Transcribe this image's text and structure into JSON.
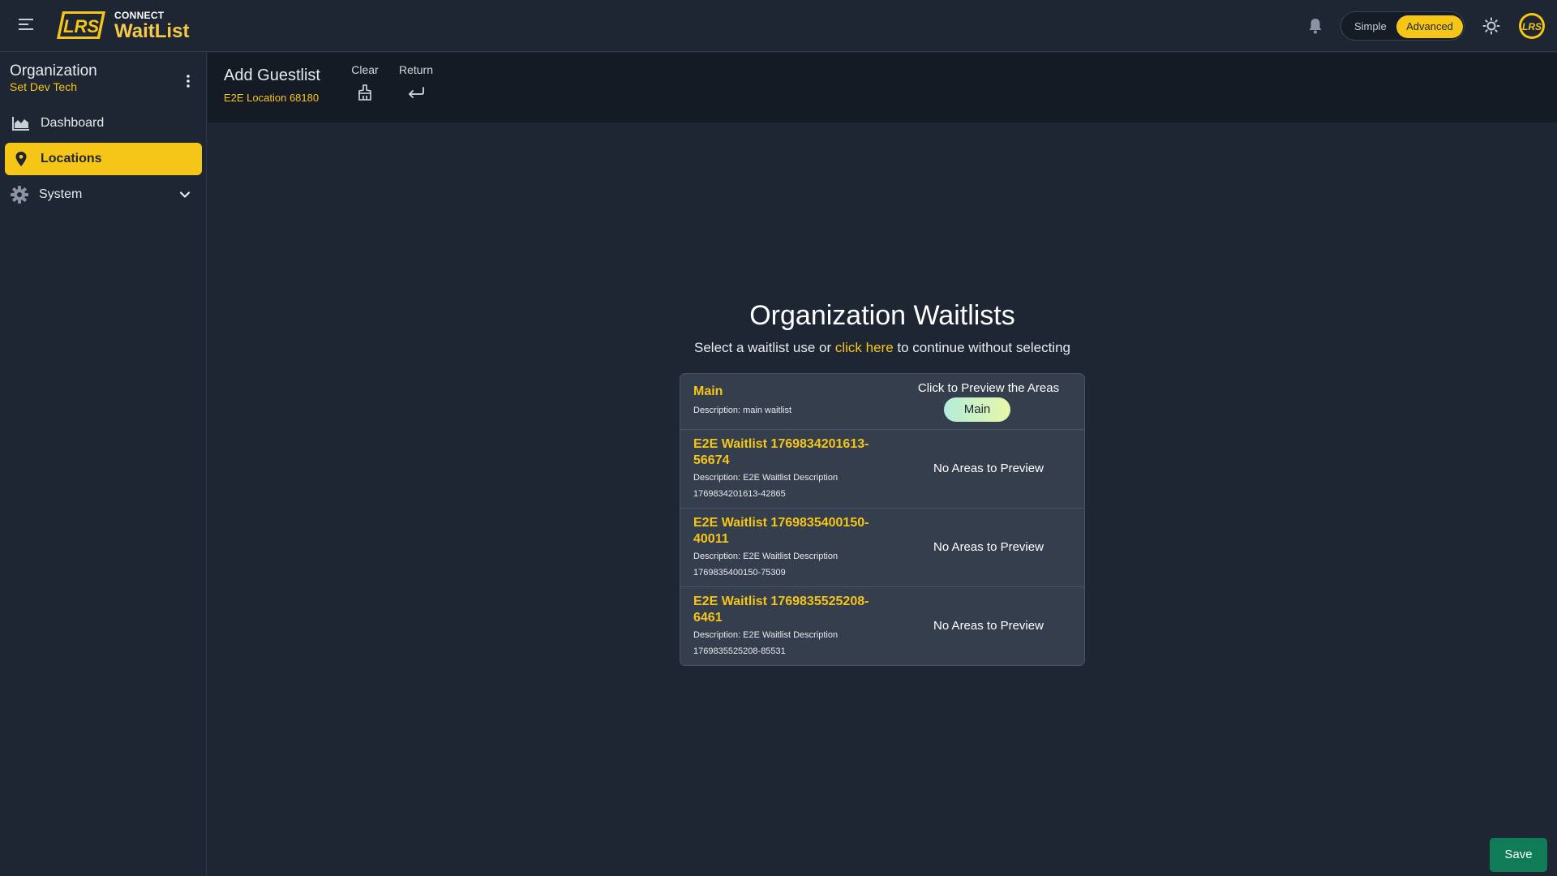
{
  "app": {
    "logo_badge": "LRS",
    "logo_small": "CONNECT",
    "logo_big": "WaitList",
    "avatar_text": "LRS"
  },
  "header": {
    "mode_simple": "Simple",
    "mode_advanced": "Advanced",
    "active_mode": "Advanced"
  },
  "sidebar": {
    "org_title": "Organization",
    "org_name": "Set Dev Tech",
    "items": [
      {
        "label": "Dashboard",
        "icon": "chart-area-icon",
        "active": false
      },
      {
        "label": "Locations",
        "icon": "map-pin-icon",
        "active": true
      },
      {
        "label": "System",
        "icon": "gear-icon",
        "active": false,
        "expandable": true
      }
    ]
  },
  "subheader": {
    "title": "Add Guestlist",
    "location": "E2E Location 68180",
    "clear_label": "Clear",
    "return_label": "Return"
  },
  "main": {
    "title": "Organization Waitlists",
    "sub_before": "Select a waitlist use or ",
    "sub_link": "click here",
    "sub_after": " to continue without selecting",
    "waitlists": [
      {
        "name": "Main",
        "description": "Description: main waitlist",
        "preview_label": "Click to Preview the Areas",
        "areas": [
          "Main"
        ]
      },
      {
        "name": "E2E Waitlist 1769834201613-56674",
        "description": "Description: E2E Waitlist Description 1769834201613-42865",
        "preview_label": "No Areas to Preview",
        "areas": []
      },
      {
        "name": "E2E Waitlist 1769835400150-40011",
        "description": "Description: E2E Waitlist Description 1769835400150-75309",
        "preview_label": "No Areas to Preview",
        "areas": []
      },
      {
        "name": "E2E Waitlist 1769835525208-6461",
        "description": "Description: E2E Waitlist Description 1769835525208-85531",
        "preview_label": "No Areas to Preview",
        "areas": []
      }
    ],
    "save_label": "Save"
  },
  "colors": {
    "accent": "#f5c518",
    "background": "#1e2633",
    "card": "#353e4c",
    "save": "#0f7c57"
  }
}
